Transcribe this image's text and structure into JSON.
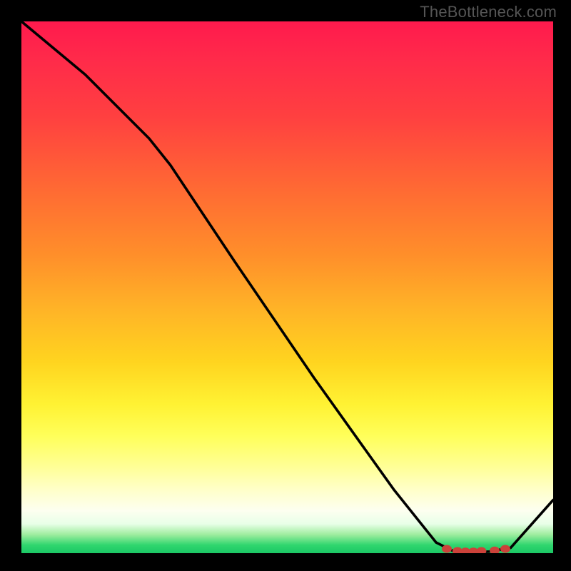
{
  "attribution": "TheBottleneck.com",
  "chart_data": {
    "type": "line",
    "title": "",
    "xlabel": "",
    "ylabel": "",
    "xlim": [
      0,
      100
    ],
    "ylim": [
      0,
      100
    ],
    "background_metric": "bottleneck_severity_gradient",
    "curve": {
      "name": "bottleneck",
      "points": [
        {
          "x": 0,
          "y": 100
        },
        {
          "x": 12,
          "y": 90
        },
        {
          "x": 24,
          "y": 78
        },
        {
          "x": 28,
          "y": 73
        },
        {
          "x": 40,
          "y": 55
        },
        {
          "x": 55,
          "y": 33
        },
        {
          "x": 70,
          "y": 12
        },
        {
          "x": 78,
          "y": 2
        },
        {
          "x": 82,
          "y": 0
        },
        {
          "x": 88,
          "y": 0.3
        },
        {
          "x": 92,
          "y": 1
        },
        {
          "x": 100,
          "y": 10
        }
      ]
    },
    "markers": [
      {
        "x": 80,
        "y": 0.8
      },
      {
        "x": 82,
        "y": 0.4
      },
      {
        "x": 83.5,
        "y": 0.3
      },
      {
        "x": 85,
        "y": 0.3
      },
      {
        "x": 86.5,
        "y": 0.4
      },
      {
        "x": 89,
        "y": 0.5
      },
      {
        "x": 91,
        "y": 0.8
      }
    ],
    "colors": {
      "curve": "#000000",
      "marker": "#cc423a",
      "gradient_top": "#ff1a4d",
      "gradient_mid": "#ffd41f",
      "gradient_bottom": "#1bc765"
    }
  }
}
